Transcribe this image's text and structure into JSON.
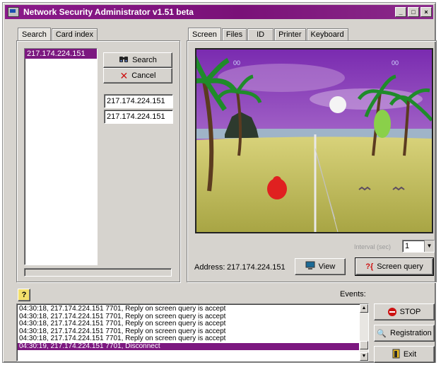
{
  "window": {
    "title": "Network Security Administrator v1.51 beta"
  },
  "left_tabs": [
    {
      "label": "Search"
    },
    {
      "label": "Card index"
    }
  ],
  "search": {
    "list_items": [
      "217.174.224.151"
    ],
    "search_label": "Search",
    "cancel_label": "Cancel",
    "field1_value": "217.174.224.151",
    "field2_value": "217.174.224.151"
  },
  "right_tabs": [
    {
      "label": "Screen"
    },
    {
      "label": "Files"
    },
    {
      "label": "ID"
    },
    {
      "label": "Printer"
    },
    {
      "label": "Keyboard"
    }
  ],
  "screen": {
    "hud_left": "00",
    "hud_right": "00",
    "interval_label": "Interval (sec)",
    "interval_value": "1",
    "address_label": "Address:",
    "address_value": "217.174.224.151",
    "view_label": "View",
    "screen_query_label": "Screen query"
  },
  "events": {
    "help_label": "?",
    "label": "Events:",
    "log": [
      "04:30:18, 217.174.224.151 7701, Reply on screen query is accept",
      "04:30:18, 217.174.224.151 7701, Reply on screen query is accept",
      "04:30:18, 217.174.224.151 7701, Reply on screen query is accept",
      "04:30:18, 217.174.224.151 7701, Reply on screen query is accept",
      "04:30:18, 217.174.224.151 7701, Reply on screen query is accept",
      "04:30:19, 217.174.224.151 7701, Disconnect"
    ],
    "selected_index": 5
  },
  "actions": {
    "stop_label": "STOP",
    "registration_label": "Registration",
    "exit_label": "Exit"
  },
  "colors": {
    "title_bar": "#7a1178",
    "selection": "#7c1880",
    "face": "#d6d3ce"
  }
}
